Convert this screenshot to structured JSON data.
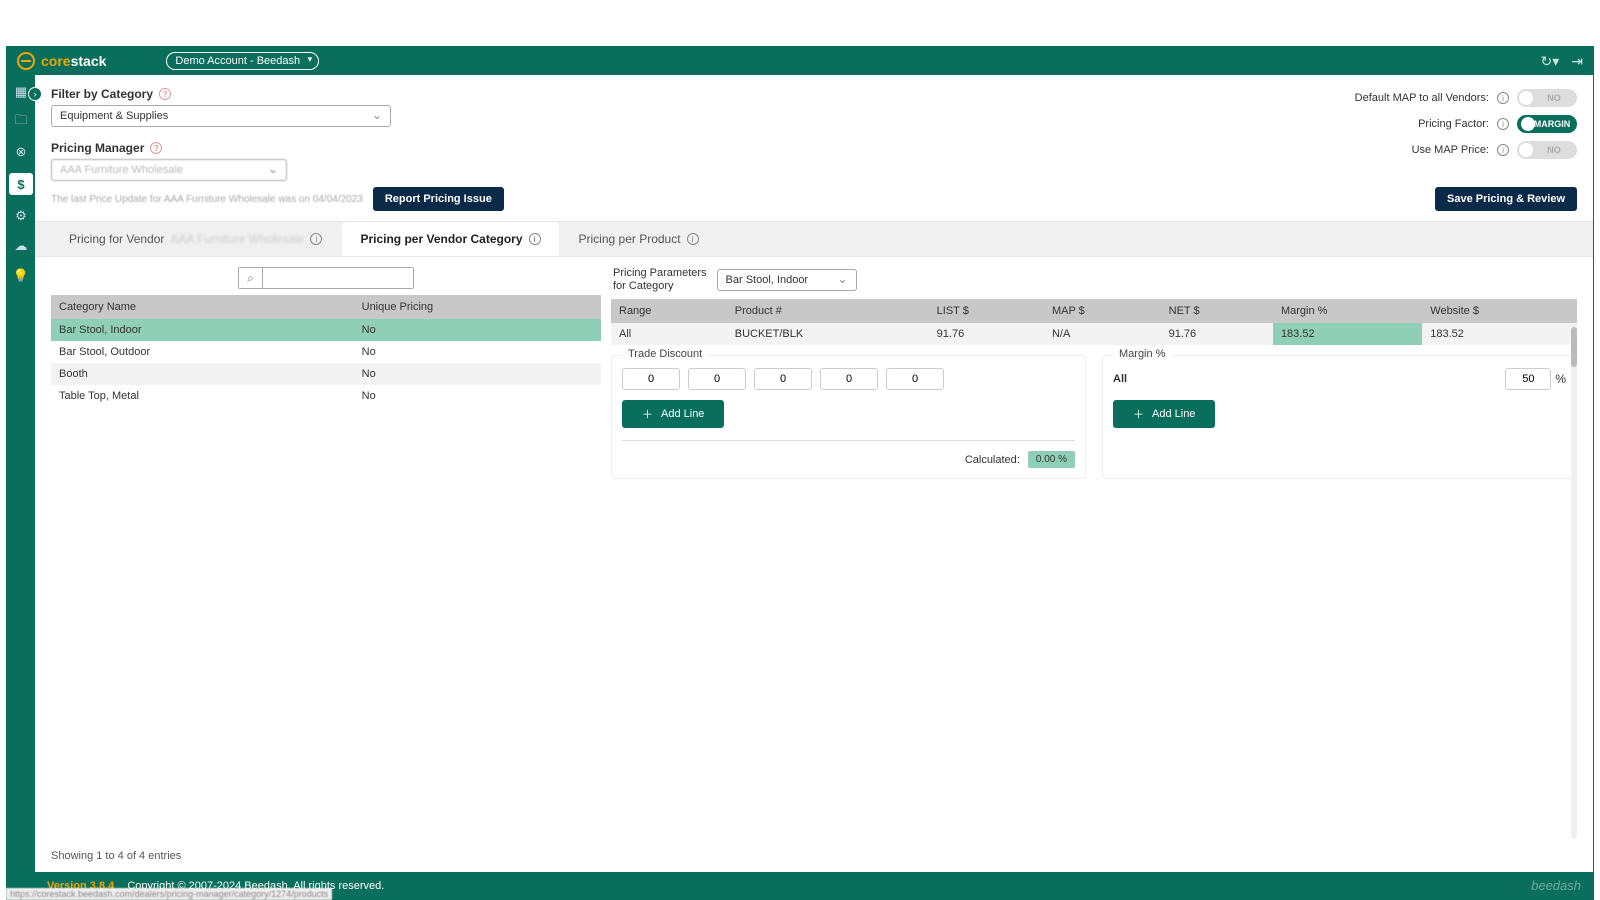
{
  "brand": {
    "core": "core",
    "stack": "stack"
  },
  "account": "Demo Account - Beedash",
  "filters": {
    "filter_by_category_label": "Filter by Category",
    "category_value": "Equipment & Supplies",
    "pricing_manager_label": "Pricing Manager",
    "pricing_manager_value": "AAA Furniture Wholesale",
    "last_update": "The last Price Update for AAA Furniture Wholesale was on 04/04/2023"
  },
  "toggles": {
    "default_map_label": "Default MAP to all Vendors:",
    "default_map_value": "NO",
    "pricing_factor_label": "Pricing Factor:",
    "pricing_factor_value": "MARGIN",
    "use_map_label": "Use MAP Price:",
    "use_map_value": "NO"
  },
  "buttons": {
    "report_issue": "Report Pricing Issue",
    "save_review": "Save Pricing & Review",
    "add_line": "Add Line"
  },
  "tabs": {
    "t1_prefix": "Pricing for Vendor",
    "t1_vendor": "AAA Furniture Wholesale",
    "t2": "Pricing per Vendor Category",
    "t3": "Pricing per Product"
  },
  "cat_table": {
    "col1": "Category Name",
    "col2": "Unique Pricing",
    "rows": [
      {
        "name": "Bar Stool, Indoor",
        "unique": "No"
      },
      {
        "name": "Bar Stool, Outdoor",
        "unique": "No"
      },
      {
        "name": "Booth",
        "unique": "No"
      },
      {
        "name": "Table Top, Metal",
        "unique": "No"
      }
    ],
    "footer": "Showing 1 to 4 of 4 entries"
  },
  "params": {
    "label_line1": "Pricing Parameters",
    "label_line2": "for Category",
    "selected": "Bar Stool, Indoor"
  },
  "price_table": {
    "cols": {
      "range": "Range",
      "product": "Product #",
      "list": "LIST $",
      "map": "MAP $",
      "net": "NET $",
      "margin": "Margin %",
      "website": "Website $"
    },
    "row": {
      "range": "All",
      "product": "BUCKET/BLK",
      "list": "91.76",
      "map": "N/A",
      "net": "91.76",
      "margin": "183.52",
      "website": "183.52"
    }
  },
  "trade_discount": {
    "title": "Trade Discount",
    "values": [
      "0",
      "0",
      "0",
      "0",
      "0"
    ],
    "calculated_label": "Calculated:",
    "calculated_value": "0.00 %"
  },
  "margin_card": {
    "title": "Margin %",
    "all_label": "All",
    "value": "50",
    "unit": "%"
  },
  "footer": {
    "version": "Version 3.8.4",
    "copyright": "Copyright © 2007-2024 Beedash. All rights reserved.",
    "brand": "beedash"
  },
  "status_url": "https://corestack.beedash.com/dealers/pricing-manager/category/1274/products"
}
